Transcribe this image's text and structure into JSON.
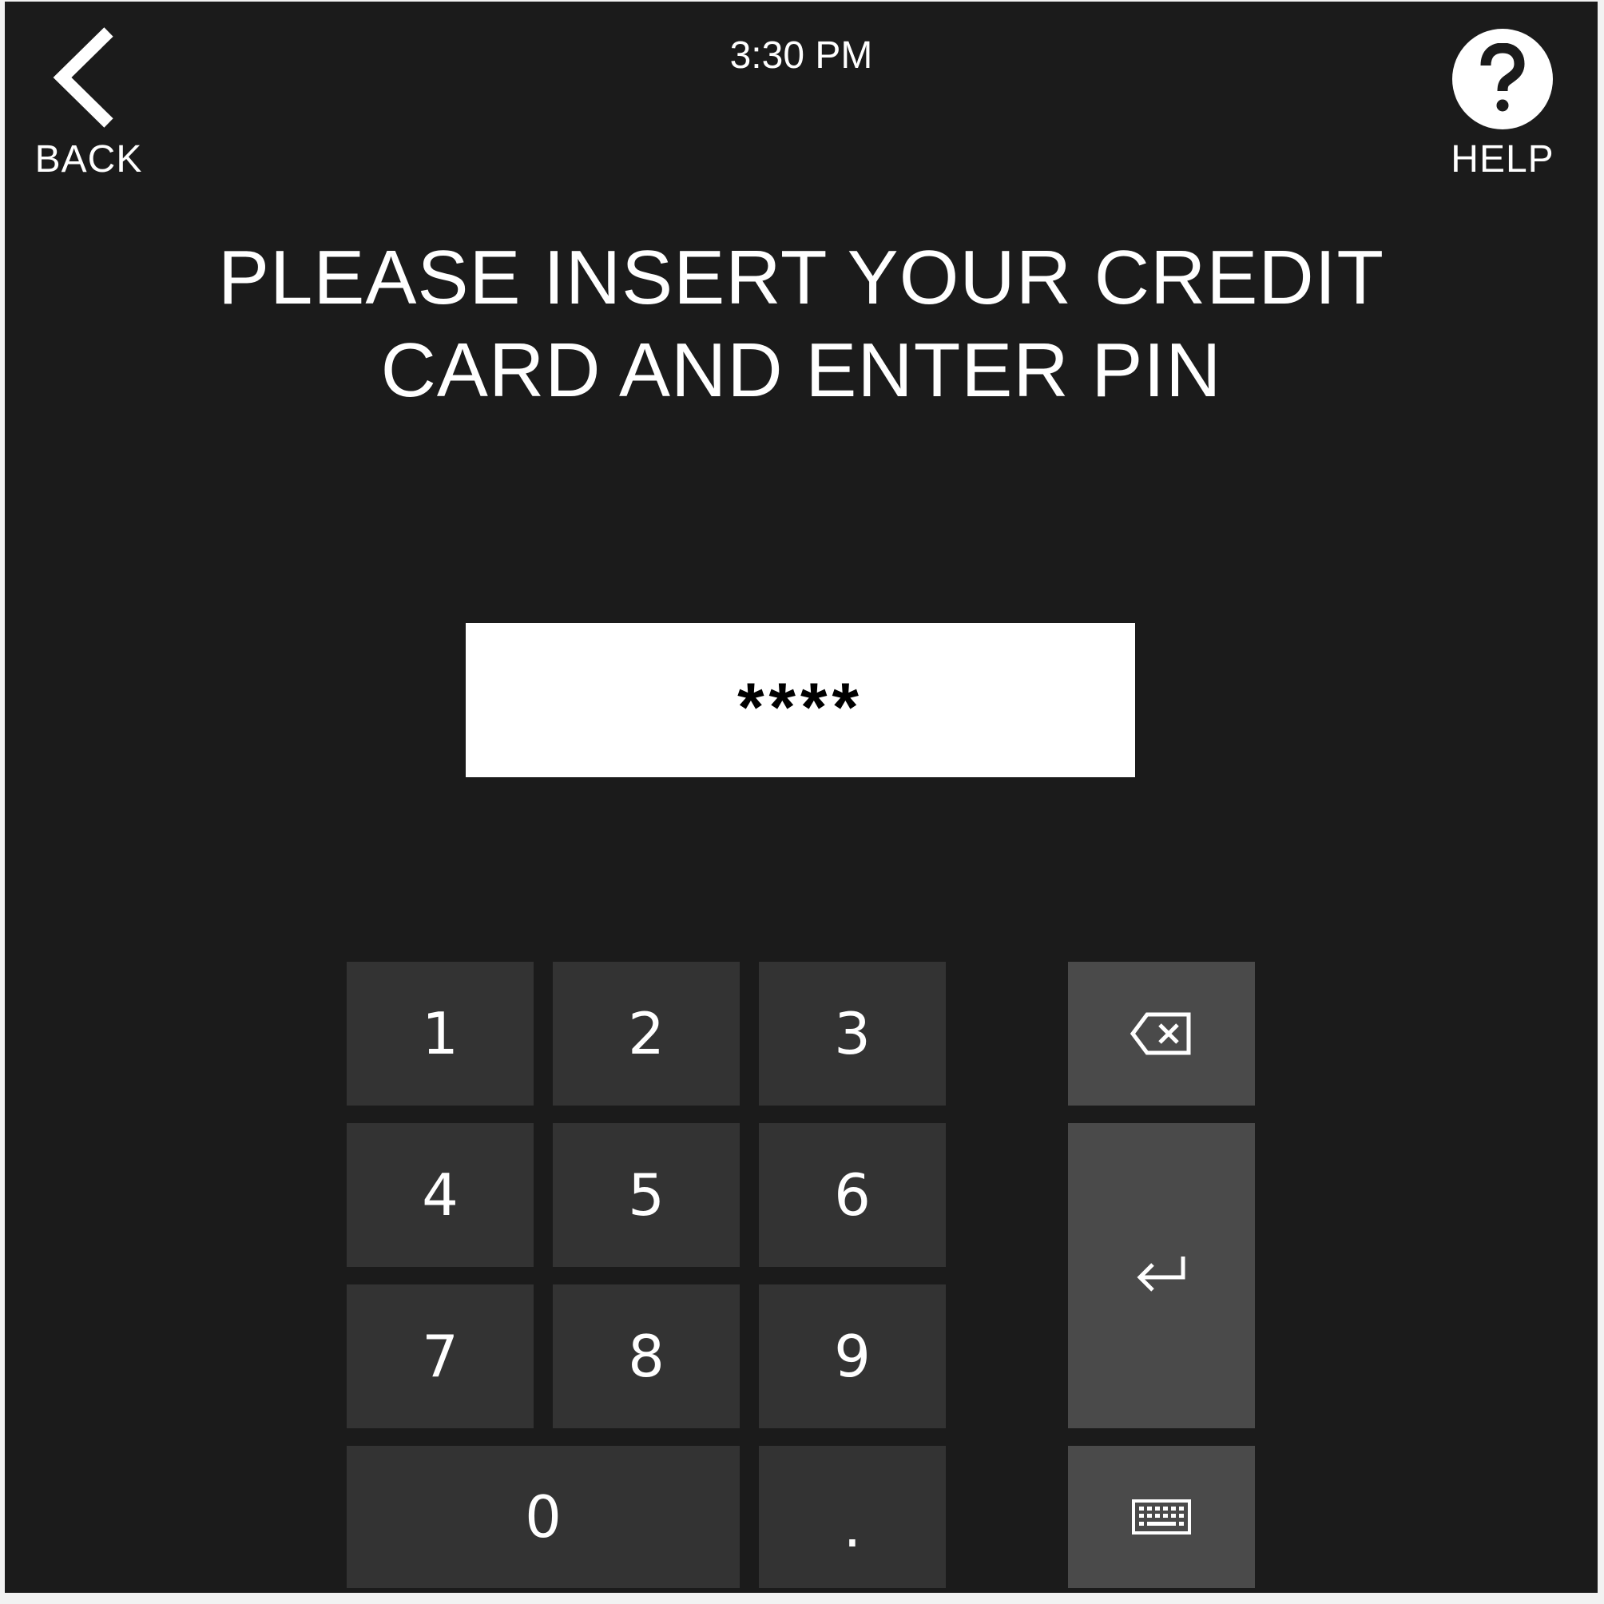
{
  "header": {
    "back_label": "BACK",
    "time": "3:30 PM",
    "help_label": "HELP"
  },
  "prompt": {
    "line1": "PLEASE INSERT YOUR CREDIT",
    "line2": "CARD AND ENTER PIN"
  },
  "pin_field": {
    "value": "****"
  },
  "keypad": {
    "keys": [
      "1",
      "2",
      "3",
      "4",
      "5",
      "6",
      "7",
      "8",
      "9",
      "0",
      "."
    ],
    "function_keys": [
      "backspace-icon",
      "enter-icon",
      "keyboard-icon"
    ]
  },
  "colors": {
    "background": "#1b1b1b",
    "key": "#333333",
    "function_key": "#4a4a4a",
    "text": "#ffffff",
    "pin_field": "#ffffff"
  }
}
